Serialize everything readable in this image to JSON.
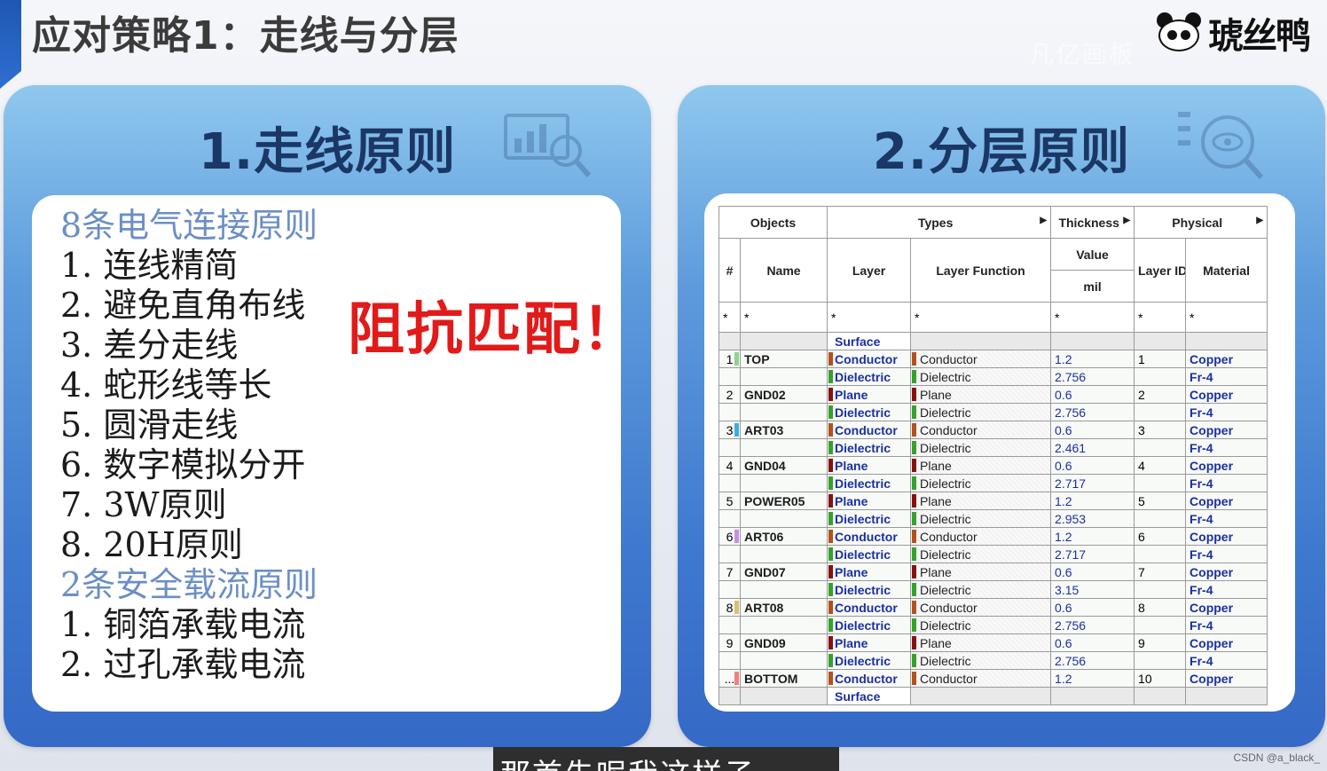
{
  "slide": {
    "title": "应对策略1：走线与分层",
    "logo_text": "琥丝鸭",
    "watermark": "凡亿画板"
  },
  "left_panel": {
    "heading": "1.走线原则",
    "lines": [
      {
        "text": "8条电气连接原则",
        "head": true
      },
      {
        "text": "1. 连线精简",
        "head": false
      },
      {
        "text": "2. 避免直角布线",
        "head": false
      },
      {
        "text": "3. 差分走线",
        "head": false
      },
      {
        "text": "4. 蛇形线等长",
        "head": false
      },
      {
        "text": "5. 圆滑走线",
        "head": false
      },
      {
        "text": "6. 数字模拟分开",
        "head": false
      },
      {
        "text": "7. 3W原则",
        "head": false
      },
      {
        "text": "8. 20H原则",
        "head": false
      },
      {
        "text": "2条安全载流原则",
        "head": true
      },
      {
        "text": "1. 铜箔承载电流",
        "head": false
      },
      {
        "text": "2. 过孔承载电流",
        "head": false
      }
    ],
    "callout": "阻抗匹配！"
  },
  "right_panel": {
    "heading": "2.分层原则",
    "table": {
      "group_headers": {
        "objects": "Objects",
        "types": "Types",
        "thickness": "Thickness",
        "physical": "Physical"
      },
      "col_headers": {
        "num": "#",
        "name": "Name",
        "layer": "Layer",
        "layer_function": "Layer Function",
        "value": "Value",
        "unit": "mil",
        "layer_id": "Layer ID",
        "material": "Material"
      },
      "filter": "*",
      "surface_label": "Surface",
      "rows": [
        {
          "num": "1",
          "name": "TOP",
          "layer": "Conductor",
          "func": "Conductor",
          "thick": "1.2",
          "id": "1",
          "mat": "Copper",
          "color": "#8bd48b"
        },
        {
          "num": "",
          "name": "",
          "layer": "Dielectric",
          "func": "Dielectric",
          "thick": "2.756",
          "id": "",
          "mat": "Fr-4",
          "color": ""
        },
        {
          "num": "2",
          "name": "GND02",
          "layer": "Plane",
          "func": "Plane",
          "thick": "0.6",
          "id": "2",
          "mat": "Copper",
          "color": ""
        },
        {
          "num": "",
          "name": "",
          "layer": "Dielectric",
          "func": "Dielectric",
          "thick": "2.756",
          "id": "",
          "mat": "Fr-4",
          "color": ""
        },
        {
          "num": "3",
          "name": "ART03",
          "layer": "Conductor",
          "func": "Conductor",
          "thick": "0.6",
          "id": "3",
          "mat": "Copper",
          "color": "#3ab0e0"
        },
        {
          "num": "",
          "name": "",
          "layer": "Dielectric",
          "func": "Dielectric",
          "thick": "2.461",
          "id": "",
          "mat": "Fr-4",
          "color": ""
        },
        {
          "num": "4",
          "name": "GND04",
          "layer": "Plane",
          "func": "Plane",
          "thick": "0.6",
          "id": "4",
          "mat": "Copper",
          "color": ""
        },
        {
          "num": "",
          "name": "",
          "layer": "Dielectric",
          "func": "Dielectric",
          "thick": "2.717",
          "id": "",
          "mat": "Fr-4",
          "color": ""
        },
        {
          "num": "5",
          "name": "POWER05",
          "layer": "Plane",
          "func": "Plane",
          "thick": "1.2",
          "id": "5",
          "mat": "Copper",
          "color": ""
        },
        {
          "num": "",
          "name": "",
          "layer": "Dielectric",
          "func": "Dielectric",
          "thick": "2.953",
          "id": "",
          "mat": "Fr-4",
          "color": ""
        },
        {
          "num": "6",
          "name": "ART06",
          "layer": "Conductor",
          "func": "Conductor",
          "thick": "1.2",
          "id": "6",
          "mat": "Copper",
          "color": "#c58de8"
        },
        {
          "num": "",
          "name": "",
          "layer": "Dielectric",
          "func": "Dielectric",
          "thick": "2.717",
          "id": "",
          "mat": "Fr-4",
          "color": ""
        },
        {
          "num": "7",
          "name": "GND07",
          "layer": "Plane",
          "func": "Plane",
          "thick": "0.6",
          "id": "7",
          "mat": "Copper",
          "color": ""
        },
        {
          "num": "",
          "name": "",
          "layer": "Dielectric",
          "func": "Dielectric",
          "thick": "3.15",
          "id": "",
          "mat": "Fr-4",
          "color": ""
        },
        {
          "num": "8",
          "name": "ART08",
          "layer": "Conductor",
          "func": "Conductor",
          "thick": "0.6",
          "id": "8",
          "mat": "Copper",
          "color": "#d8c070"
        },
        {
          "num": "",
          "name": "",
          "layer": "Dielectric",
          "func": "Dielectric",
          "thick": "2.756",
          "id": "",
          "mat": "Fr-4",
          "color": ""
        },
        {
          "num": "9",
          "name": "GND09",
          "layer": "Plane",
          "func": "Plane",
          "thick": "0.6",
          "id": "9",
          "mat": "Copper",
          "color": ""
        },
        {
          "num": "",
          "name": "",
          "layer": "Dielectric",
          "func": "Dielectric",
          "thick": "2.756",
          "id": "",
          "mat": "Fr-4",
          "color": ""
        },
        {
          "num": "...",
          "name": "BOTTOM",
          "layer": "Conductor",
          "func": "Conductor",
          "thick": "1.2",
          "id": "10",
          "mat": "Copper",
          "color": "#f08080"
        }
      ],
      "swatch_colors": {
        "Conductor": "#b5511c",
        "Dielectric": "#35a22b",
        "Plane": "#8a1010"
      }
    }
  },
  "overlay": {
    "subtitle": "那首先呢我这样子",
    "credit": "CSDN @a_black_"
  }
}
